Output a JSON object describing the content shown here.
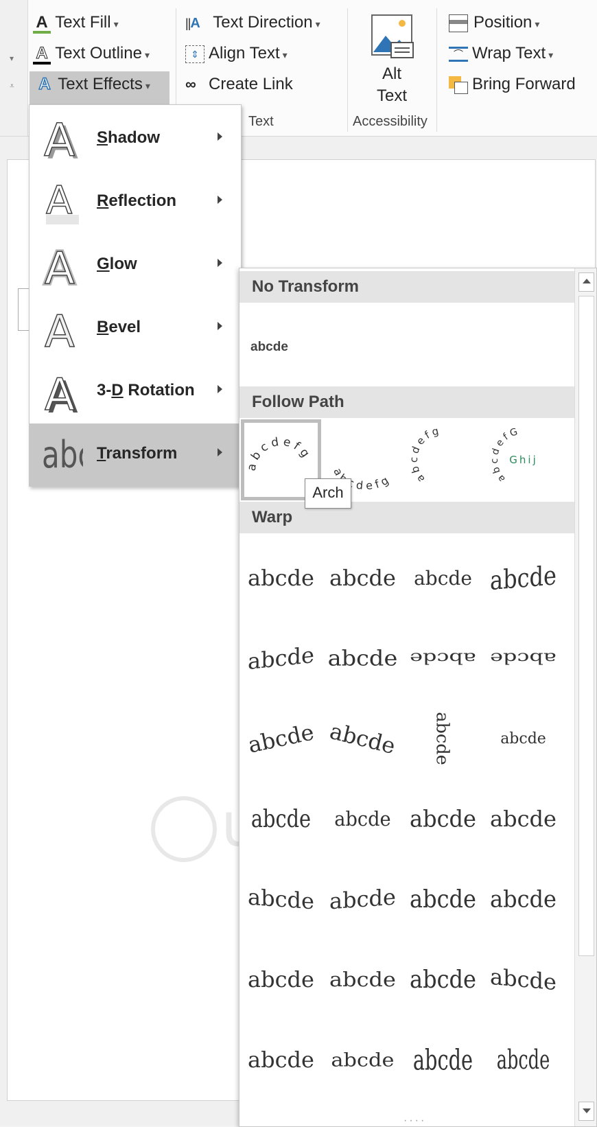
{
  "ribbon": {
    "font_group": {
      "text_fill": "Text Fill",
      "text_outline": "Text Outline",
      "text_effects": "Text Effects"
    },
    "text_group": {
      "text_direction": "Text Direction",
      "align_text": "Align Text",
      "create_link": "Create Link",
      "label": "Text"
    },
    "accessibility_group": {
      "alt_text_line1": "Alt",
      "alt_text_line2": "Text",
      "label": "Accessibility"
    },
    "arrange_group": {
      "position": "Position",
      "wrap_text": "Wrap Text",
      "bring_forward": "Bring Forward"
    }
  },
  "effects_menu": {
    "items": [
      {
        "label": "Shadow",
        "key": "S",
        "rest": "hadow"
      },
      {
        "label": "Reflection",
        "key": "R",
        "rest": "eflection"
      },
      {
        "label": "Glow",
        "key": "G",
        "rest": "low"
      },
      {
        "label": "Bevel",
        "key": "B",
        "rest": "evel"
      },
      {
        "label": "3-D Rotation",
        "pre": "3-",
        "key": "D",
        "rest": " Rotation"
      },
      {
        "label": "Transform",
        "key": "T",
        "rest": "ransform"
      }
    ],
    "selected": "Transform"
  },
  "transform_gallery": {
    "sections": {
      "no_transform": "No Transform",
      "follow_path": "Follow Path",
      "warp": "Warp"
    },
    "no_transform_sample": "abcde",
    "follow_path_samples": [
      "abcdefg",
      "abcdefg",
      "abcdefghijklm",
      "abcdefGhijklmno"
    ],
    "follow_path_inner": "Ghij",
    "warp_sample": "abcde",
    "warp_rows": 7,
    "tooltip": "Arch"
  },
  "watermark": "uantrimang",
  "colors": {
    "accent_green": "#70ad47",
    "accent_blue": "#2f75b5",
    "selected_gray": "#c7c7c7",
    "header_gray": "#e4e4e4"
  }
}
